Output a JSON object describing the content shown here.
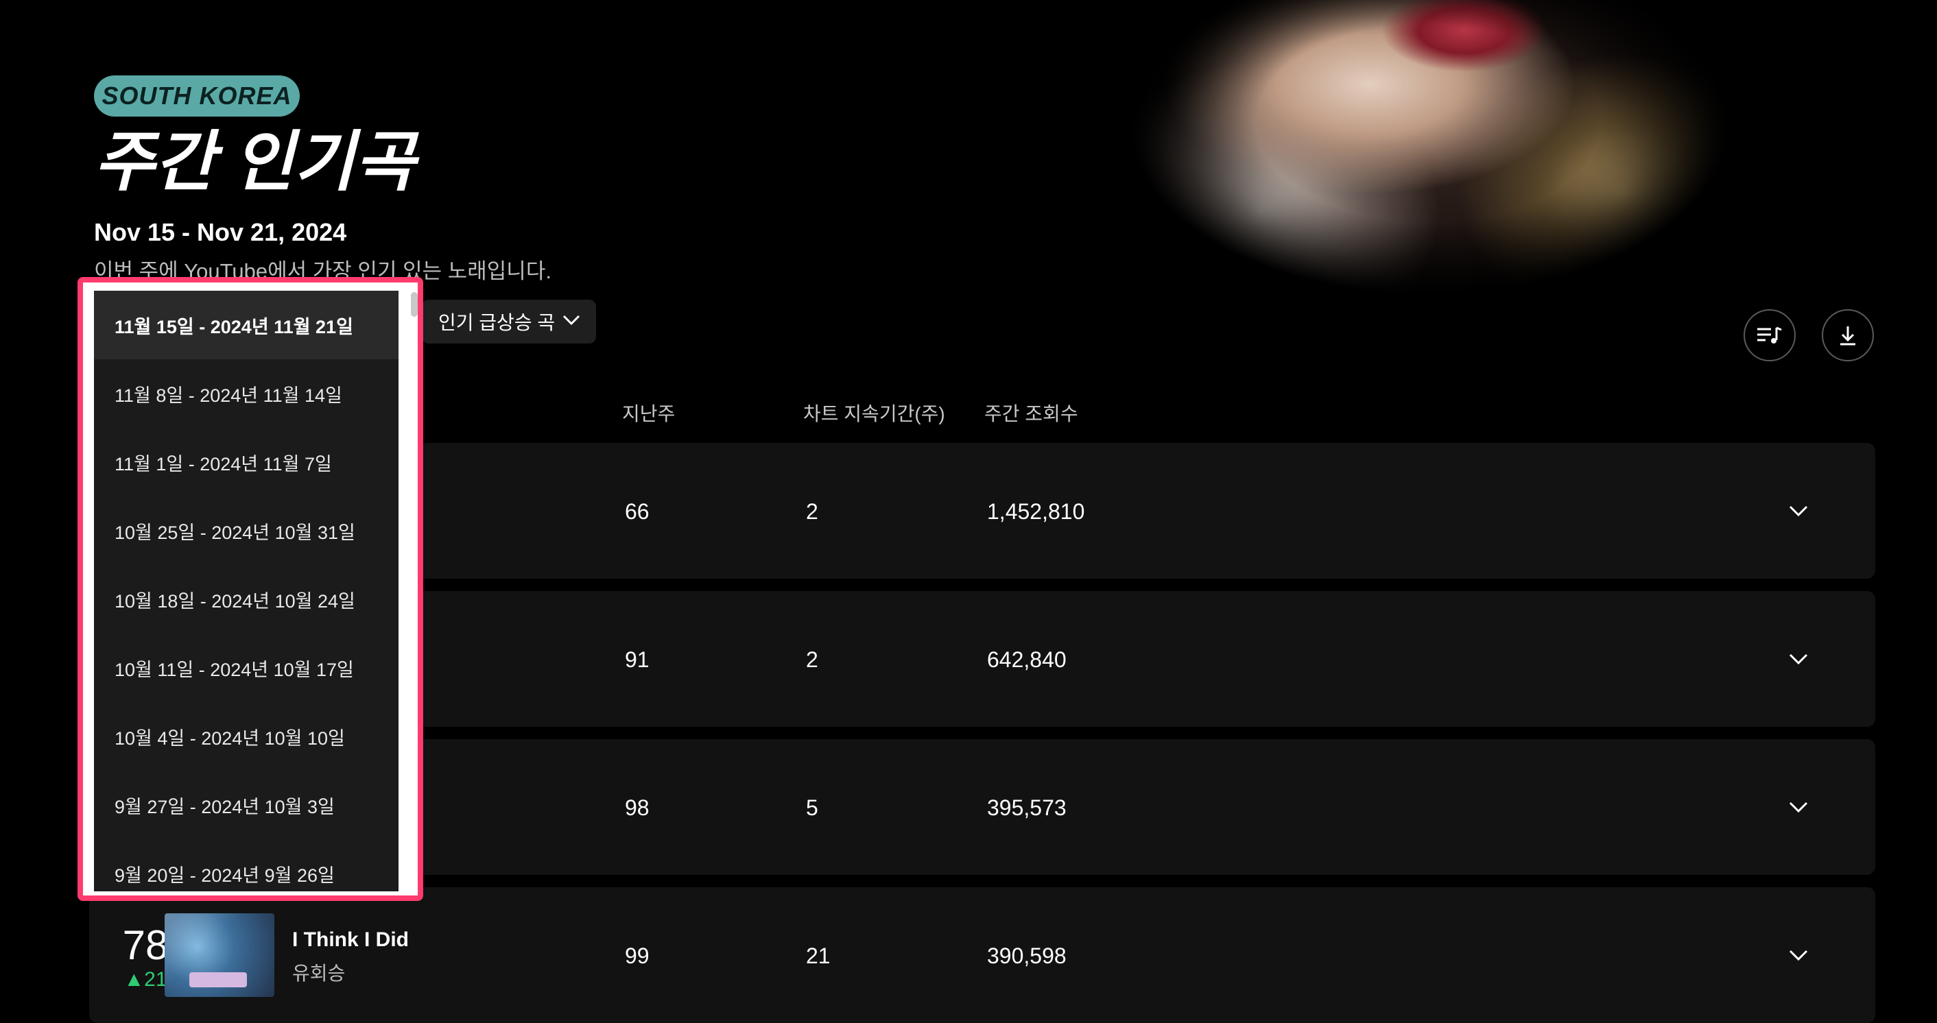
{
  "header": {
    "region_badge": "SOUTH KOREA",
    "title": "주간 인기곡",
    "date_range": "Nov 15 - Nov 21, 2024",
    "subtitle": "이번 주에 YouTube에서 가장 인기 있는 노래입니다."
  },
  "filters": {
    "trend_dropdown_label": "인기 급상승 곡"
  },
  "toolbar": {
    "playlist_icon": "playlist-music-icon",
    "download_icon": "download-icon"
  },
  "table": {
    "columns": {
      "last_week": "지난주",
      "weeks_on_chart": "차트 지속기간(주)",
      "weekly_views": "주간 조회수"
    },
    "rows": [
      {
        "last_week": "66",
        "weeks_on_chart": "2",
        "weekly_views": "1,452,810"
      },
      {
        "last_week": "91",
        "weeks_on_chart": "2",
        "weekly_views": "642,840"
      },
      {
        "last_week": "98",
        "weeks_on_chart": "5",
        "weekly_views": "395,573"
      },
      {
        "rank": "78",
        "rank_change": "▲21",
        "title": "I Think I Did",
        "artist": "유회승",
        "last_week": "99",
        "weeks_on_chart": "21",
        "weekly_views": "390,598"
      }
    ]
  },
  "week_picker": {
    "selected_index": 0,
    "options": [
      "11월 15일 - 2024년 11월 21일",
      "11월 8일 - 2024년 11월 14일",
      "11월 1일 - 2024년 11월 7일",
      "10월 25일 - 2024년 10월 31일",
      "10월 18일 - 2024년 10월 24일",
      "10월 11일 - 2024년 10월 17일",
      "10월 4일 - 2024년 10월 10일",
      "9월 27일 - 2024년 10월 3일",
      "9월 20일 - 2024년 9월 26일"
    ]
  },
  "colors": {
    "badge": "#5aa9a6",
    "popup_outline": "#ff3b6e",
    "rank_up": "#2ecc71"
  }
}
